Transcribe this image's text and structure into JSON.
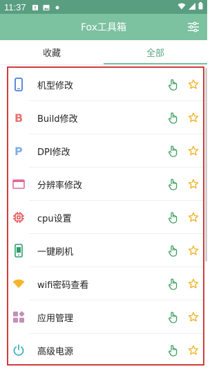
{
  "status": {
    "time": "11:37"
  },
  "app": {
    "title": "Fox工具箱"
  },
  "tabs": [
    {
      "label": "收藏"
    },
    {
      "label": "全部"
    }
  ],
  "items": [
    {
      "label": "机型修改",
      "icon": "phone-icon"
    },
    {
      "label": "Build修改",
      "icon": "letter-b-icon"
    },
    {
      "label": "DPI修改",
      "icon": "letter-p-icon"
    },
    {
      "label": "分辨率修改",
      "icon": "window-icon"
    },
    {
      "label": "cpu设置",
      "icon": "chip-icon"
    },
    {
      "label": "一键刷机",
      "icon": "phone-android-icon"
    },
    {
      "label": "wifi密码查看",
      "icon": "wifi-icon"
    },
    {
      "label": "应用管理",
      "icon": "apps-icon"
    },
    {
      "label": "高级电源",
      "icon": "power-icon"
    }
  ],
  "colors": {
    "statusbar": "#5a9e82",
    "appbar": "#7cc1a0",
    "accent": "#5aa585",
    "highlight_frame": "#d23a3a",
    "star": "#f2b01e"
  }
}
